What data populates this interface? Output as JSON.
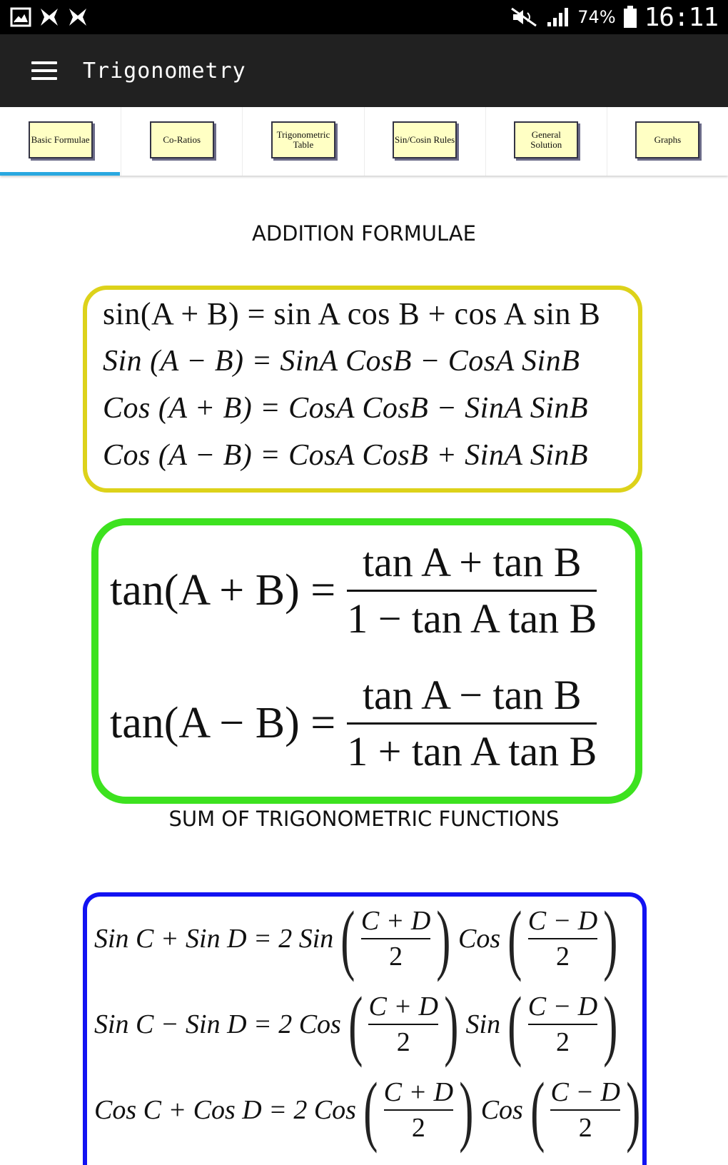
{
  "status_bar": {
    "battery": "74%",
    "time": "16:11",
    "icons": [
      "gallery-icon",
      "notification-x-icon",
      "notification-x-icon",
      "mute-icon",
      "signal-icon",
      "battery-icon"
    ]
  },
  "app_bar": {
    "title": "Trigonometry",
    "menu_icon": "hamburger-menu-icon"
  },
  "tabs": [
    {
      "label": "Basic Formulae",
      "selected": true
    },
    {
      "label": "Co-Ratios",
      "selected": false
    },
    {
      "label": "Trigonometric Table",
      "selected": false
    },
    {
      "label": "Sin/Cosin Rules",
      "selected": false
    },
    {
      "label": "General Solution",
      "selected": false
    },
    {
      "label": "Graphs",
      "selected": false
    }
  ],
  "colors": {
    "accent": "#29a8e0",
    "app_bar": "#212121",
    "yellow_box": "#ddd21a",
    "green_box": "#3de21f",
    "blue_box": "#1212f2",
    "top_box": "#5c1d33",
    "tab_chip": "#ffffc4"
  },
  "addition": {
    "title": "ADDITION FORMULAE",
    "rows": [
      "sin(A + B) = sin A cos B + cos A sin B",
      "Sin (A − B) = SinA  CosB  − CosA  SinB",
      "Cos (A + B) = CosA  CosB  − SinA  SinB",
      "Cos (A − B) = CosA  CosB  + SinA  SinB"
    ]
  },
  "tan": {
    "rows": [
      {
        "lhs": "tan(A + B) =",
        "num": "tan A + tan B",
        "den": "1 − tan A tan B"
      },
      {
        "lhs": "tan(A − B) =",
        "num": "tan A − tan B",
        "den": "1 + tan A tan B"
      }
    ]
  },
  "sum": {
    "title": "SUM OF TRIGONOMETRIC FUNCTIONS",
    "rows": [
      {
        "lhs": "Sin C + Sin D = 2 Sin",
        "f1_num": "C + D",
        "f1_den": "2",
        "mid": "Cos",
        "f2_num": "C − D",
        "f2_den": "2"
      },
      {
        "lhs": "Sin C − Sin D = 2 Cos",
        "f1_num": "C + D",
        "f1_den": "2",
        "mid": "Sin",
        "f2_num": "C − D",
        "f2_den": "2"
      },
      {
        "lhs": "Cos C + Cos D = 2 Cos",
        "f1_num": "C + D",
        "f1_den": "2",
        "mid": "Cos",
        "f2_num": "C − D",
        "f2_den": "2"
      }
    ]
  }
}
